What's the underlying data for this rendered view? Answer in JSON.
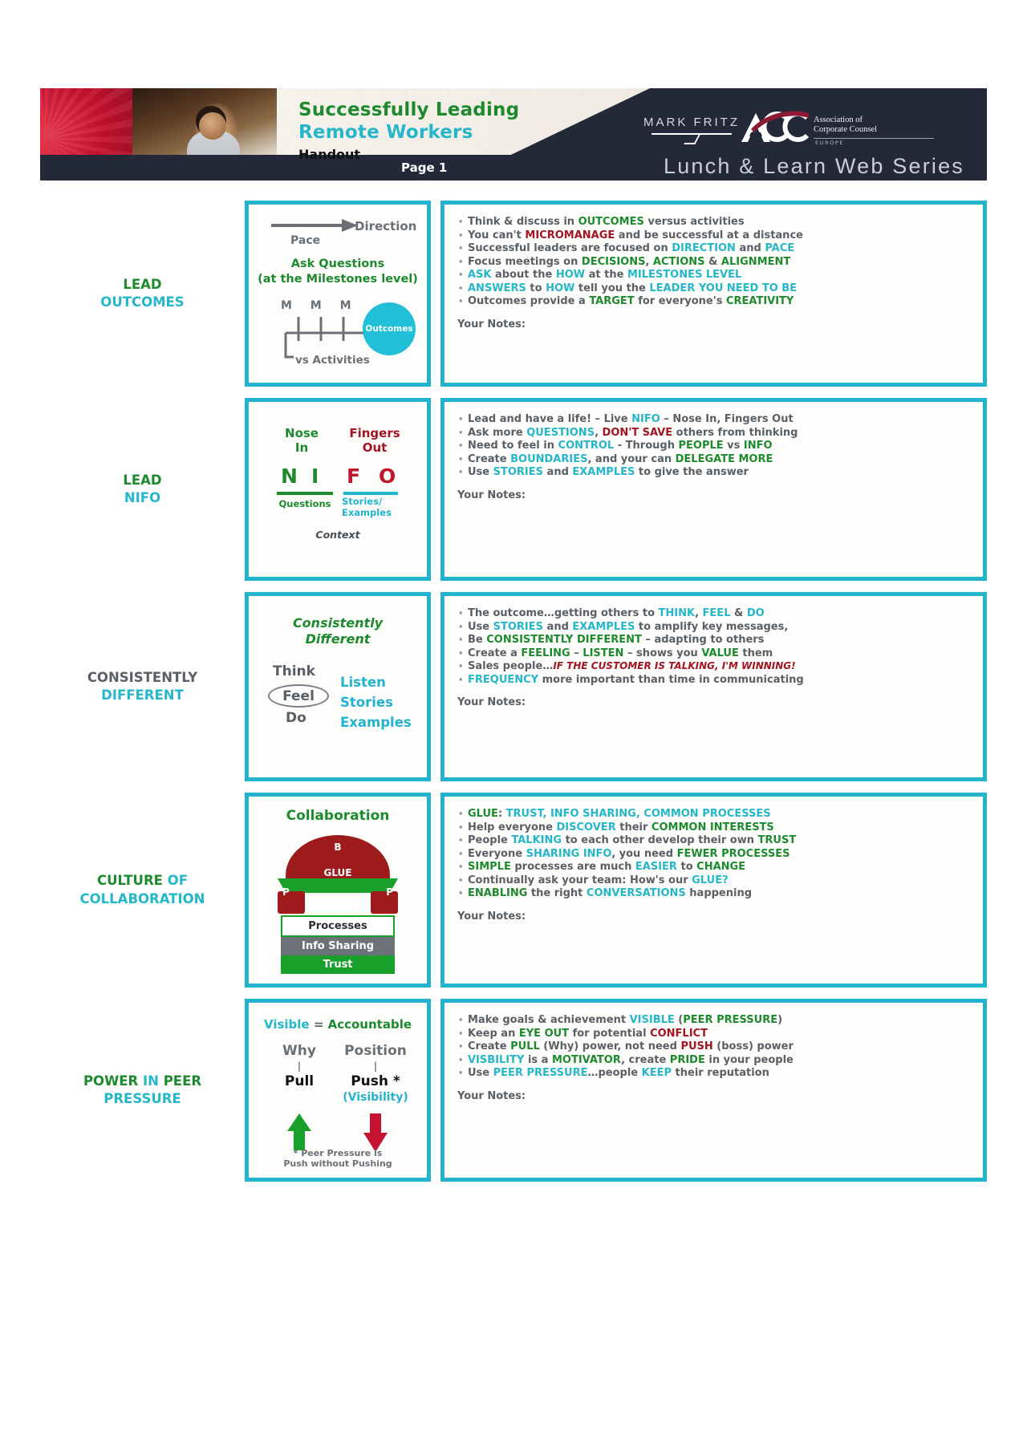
{
  "banner": {
    "title_line1": "Successfully Leading",
    "title_line2": "Remote Workers",
    "subtitle": "Handout",
    "page_label": "Page 1",
    "presenter": "MARK FRITZ",
    "acc_word1": "Association of",
    "acc_word2": "Corporate Counsel",
    "acc_region": "EUROPE",
    "series": "Lunch & Learn Web Series",
    "colors": {
      "green": "#1e8a2e",
      "cyan": "#25b7c9",
      "navy": "#232939",
      "red": "#c8102e"
    }
  },
  "rows": [
    {
      "label_parts": [
        {
          "text": "LEAD",
          "color": "green"
        },
        {
          "text": "OUTCOMES",
          "color": "cyan"
        }
      ],
      "diagram": {
        "name": "outcomes-diagram",
        "direction": "Direction",
        "pace": "Pace",
        "ask_line1": "Ask Questions",
        "ask_line2": "(at the Milestones level)",
        "milestones": "M M M",
        "circle": "Outcomes",
        "vs": "vs Activities"
      },
      "bullets": [
        [
          [
            "Think & discuss in ",
            "gy"
          ],
          [
            "OUTCOMES",
            "gr"
          ],
          [
            " versus activities",
            "gy"
          ]
        ],
        [
          [
            "You can't ",
            "gy"
          ],
          [
            "MICROMANAGE",
            "dr"
          ],
          [
            " and be successful at a distance",
            "gy"
          ]
        ],
        [
          [
            "Successful leaders are focused on ",
            "gy"
          ],
          [
            "DIRECTION",
            "cy"
          ],
          [
            " and ",
            "gy"
          ],
          [
            "PACE",
            "cy"
          ]
        ],
        [
          [
            "Focus meetings on ",
            "gy"
          ],
          [
            "DECISIONS",
            "gr"
          ],
          [
            ", ",
            "gy"
          ],
          [
            "ACTIONS",
            "gr"
          ],
          [
            " & ",
            "gy"
          ],
          [
            "ALIGNMENT",
            "gr"
          ]
        ],
        [
          [
            "ASK",
            "cy"
          ],
          [
            " about the ",
            "gy"
          ],
          [
            "HOW",
            "cy"
          ],
          [
            " at the ",
            "gy"
          ],
          [
            "MILESTONES LEVEL",
            "cy"
          ]
        ],
        [
          [
            "ANSWERS",
            "cy"
          ],
          [
            " to ",
            "gy"
          ],
          [
            "HOW",
            "cy"
          ],
          [
            " tell you the ",
            "gy"
          ],
          [
            "LEADER YOU NEED TO BE",
            "cy"
          ]
        ],
        [
          [
            "Outcomes provide a ",
            "gy"
          ],
          [
            "TARGET",
            "gr"
          ],
          [
            " for everyone's ",
            "gy"
          ],
          [
            "CREATIVITY",
            "gr"
          ]
        ]
      ],
      "notes_label": "Your Notes:"
    },
    {
      "label_parts": [
        {
          "text": "LEAD",
          "color": "green"
        },
        {
          "text": "NIFO",
          "color": "cyan"
        }
      ],
      "diagram": {
        "name": "nifo-diagram",
        "nose": "Nose\nIn",
        "nose_l1": "Nose",
        "nose_l2": "In",
        "fingers_l1": "Fingers",
        "fingers_l2": "Out",
        "letters": [
          "N",
          "I",
          "F",
          "O"
        ],
        "under_left": "Questions",
        "under_right_l1": "Stories/",
        "under_right_l2": "Examples",
        "context": "Context"
      },
      "bullets": [
        [
          [
            "Lead and have a life! – Live ",
            "gy"
          ],
          [
            "NIFO",
            "cy"
          ],
          [
            " – Nose In, Fingers Out",
            "gy"
          ]
        ],
        [
          [
            "Ask more ",
            "gy"
          ],
          [
            "QUESTIONS",
            "cy"
          ],
          [
            ", ",
            "gy"
          ],
          [
            "DON'T SAVE",
            "dr"
          ],
          [
            " others from thinking",
            "gy"
          ]
        ],
        [
          [
            "Need to feel in ",
            "gy"
          ],
          [
            "CONTROL",
            "cy"
          ],
          [
            " - Through ",
            "gy"
          ],
          [
            "PEOPLE",
            "gr"
          ],
          [
            " vs ",
            "gy"
          ],
          [
            "INFO",
            "gr"
          ]
        ],
        [
          [
            "Create ",
            "gy"
          ],
          [
            "BOUNDARIES",
            "cy"
          ],
          [
            ", and your can ",
            "gy"
          ],
          [
            "DELEGATE MORE",
            "gr"
          ]
        ],
        [
          [
            "Use ",
            "gy"
          ],
          [
            "STORIES",
            "cy"
          ],
          [
            " and ",
            "gy"
          ],
          [
            "EXAMPLES",
            "cy"
          ],
          [
            " to give the answer",
            "gy"
          ]
        ]
      ],
      "notes_label": "Your Notes:"
    },
    {
      "label_parts": [
        {
          "text": "CONSISTENTLY",
          "color": "gy"
        },
        {
          "text": "DIFFERENT",
          "color": "cyan"
        }
      ],
      "diagram": {
        "name": "consistently-different-diagram",
        "title_l1": "Consistently",
        "title_l2": "Different",
        "think": "Think",
        "feel": "Feel",
        "do": "Do",
        "right_l1": "Listen",
        "right_l2": "Stories",
        "right_l3": "Examples"
      },
      "bullets": [
        [
          [
            "The outcome…getting others to ",
            "gy"
          ],
          [
            "THINK",
            "cy"
          ],
          [
            ", ",
            "gy"
          ],
          [
            "FEEL",
            "cy"
          ],
          [
            " & ",
            "gy"
          ],
          [
            "DO",
            "cy"
          ]
        ],
        [
          [
            "Use ",
            "gy"
          ],
          [
            "STORIES",
            "cy"
          ],
          [
            " and ",
            "gy"
          ],
          [
            "EXAMPLES",
            "cy"
          ],
          [
            " to amplify key messages,",
            "gy"
          ]
        ],
        [
          [
            "Be ",
            "gy"
          ],
          [
            "CONSISTENTLY DIFFERENT",
            "gr"
          ],
          [
            " – adapting to others",
            "gy"
          ]
        ],
        [
          [
            "Create a ",
            "gy"
          ],
          [
            "FEELING",
            "gr"
          ],
          [
            " – ",
            "gy"
          ],
          [
            "LISTEN",
            "gr"
          ],
          [
            " – shows you ",
            "gy"
          ],
          [
            "VALUE",
            "gr"
          ],
          [
            " them",
            "gy"
          ]
        ],
        [
          [
            "Sales people…",
            "gy"
          ],
          [
            "IF THE CUSTOMER IS TALKING, I'M WINNING!",
            "dri"
          ]
        ],
        [
          [
            "FREQUENCY",
            "cy"
          ],
          [
            " more important than time in communicating",
            "gy"
          ]
        ]
      ],
      "notes_label": "Your Notes:"
    },
    {
      "label_parts": [
        {
          "text": "CULTURE OF",
          "color": "mix-culture"
        },
        {
          "text": "COLLABORATION",
          "color": "cyan"
        }
      ],
      "diagram": {
        "name": "collaboration-diagram",
        "title": "Collaboration",
        "arch_top": "B",
        "arch_band": "GLUE",
        "pillar_left": "P",
        "pillar_right": "P",
        "stack": [
          "Processes",
          "Info Sharing",
          "Trust"
        ]
      },
      "bullets": [
        [
          [
            "GLUE",
            "gr"
          ],
          [
            ": ",
            "gy"
          ],
          [
            "TRUST, INFO SHARING, COMMON PROCESSES",
            "cy"
          ]
        ],
        [
          [
            "Help everyone ",
            "gy"
          ],
          [
            "DISCOVER",
            "cy"
          ],
          [
            " their ",
            "gy"
          ],
          [
            "COMMON INTERESTS",
            "gr"
          ]
        ],
        [
          [
            "People ",
            "gy"
          ],
          [
            "TALKING",
            "cy"
          ],
          [
            " to each other develop their own ",
            "gy"
          ],
          [
            "TRUST",
            "gr"
          ]
        ],
        [
          [
            "Everyone ",
            "gy"
          ],
          [
            "SHARING INFO",
            "cy"
          ],
          [
            ", you need ",
            "gy"
          ],
          [
            "FEWER PROCESSES",
            "gr"
          ]
        ],
        [
          [
            "SIMPLE",
            "gr"
          ],
          [
            " processes are much ",
            "gy"
          ],
          [
            "EASIER",
            "cy"
          ],
          [
            " to ",
            "gy"
          ],
          [
            "CHANGE",
            "gr"
          ]
        ],
        [
          [
            "Continually ask your team:  How's our ",
            "gy"
          ],
          [
            "GLUE?",
            "cy"
          ]
        ],
        [
          [
            "ENABLING",
            "gr"
          ],
          [
            " the right ",
            "gy"
          ],
          [
            "CONVERSATIONS",
            "cy"
          ],
          [
            " happening",
            "gy"
          ]
        ]
      ],
      "notes_label": "Your Notes:"
    },
    {
      "label_parts": [
        {
          "text": "POWER IN PEER",
          "color": "mix-power"
        },
        {
          "text": "PRESSURE",
          "color": "cyan"
        }
      ],
      "diagram": {
        "name": "peer-pressure-diagram",
        "top_left": "Visible",
        "top_eq": " = ",
        "top_right": "Accountable",
        "why": "Why",
        "position": "Position",
        "bar": "|",
        "pull": "Pull",
        "push": "Push *",
        "visibility": "(Visibility)",
        "note_l1": "* Peer Pressure is",
        "note_l2": "Push without Pushing"
      },
      "bullets": [
        [
          [
            "Make goals & achievement ",
            "gy"
          ],
          [
            "VISIBLE",
            "cy"
          ],
          [
            " (",
            "gy"
          ],
          [
            "PEER PRESSURE",
            "gr"
          ],
          [
            ")",
            "gy"
          ]
        ],
        [
          [
            "Keep an ",
            "gy"
          ],
          [
            "EYE OUT",
            "gr"
          ],
          [
            " for potential ",
            "gy"
          ],
          [
            "CONFLICT",
            "dr"
          ]
        ],
        [
          [
            "Create ",
            "gy"
          ],
          [
            "PULL",
            "gr"
          ],
          [
            " (Why) power, not need ",
            "gy"
          ],
          [
            "PUSH",
            "dr"
          ],
          [
            " (boss) power",
            "gy"
          ]
        ],
        [
          [
            "VISBILITY",
            "cy"
          ],
          [
            " is a ",
            "gy"
          ],
          [
            "MOTIVATOR",
            "gr"
          ],
          [
            ", create ",
            "gy"
          ],
          [
            "PRIDE",
            "gr"
          ],
          [
            " in your people",
            "gy"
          ]
        ],
        [
          [
            "Use ",
            "gy"
          ],
          [
            "PEER PRESSURE",
            "cy"
          ],
          [
            "…people ",
            "gy"
          ],
          [
            "KEEP",
            "cy"
          ],
          [
            " their reputation",
            "gy"
          ]
        ]
      ],
      "notes_label": "Your Notes:"
    }
  ]
}
